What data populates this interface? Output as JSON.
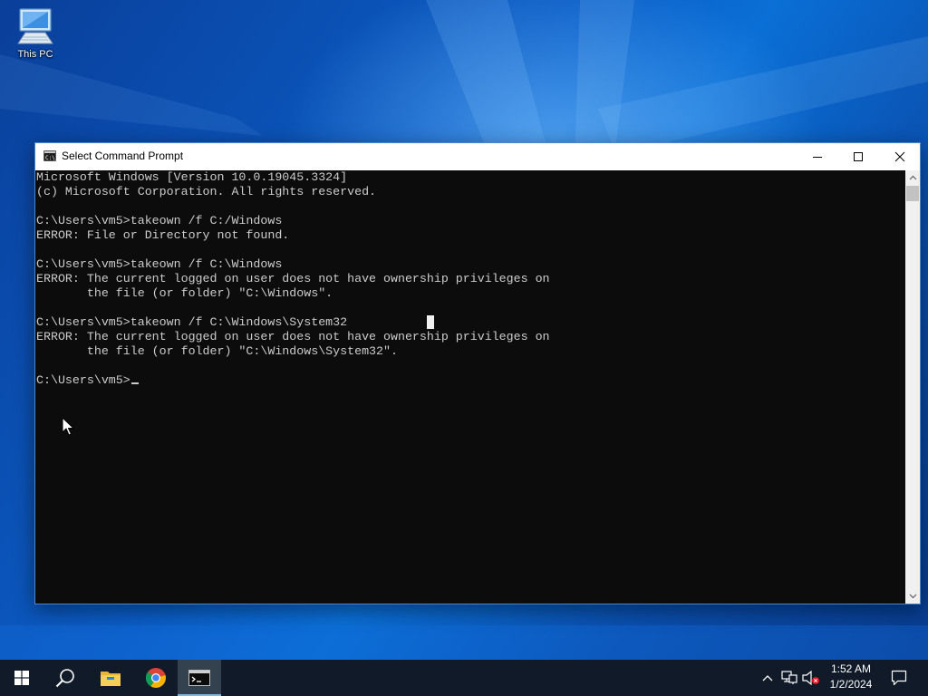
{
  "desktop": {
    "icons": [
      {
        "label": "This PC",
        "icon": "computer-icon"
      }
    ]
  },
  "window": {
    "title": "Select Command Prompt",
    "icon": "cmd-icon",
    "controls": {
      "minimize": "minimize-icon",
      "maximize": "maximize-icon",
      "close": "close-icon"
    }
  },
  "console": {
    "lines": [
      "Microsoft Windows [Version 10.0.19045.3324]",
      "(c) Microsoft Corporation. All rights reserved.",
      "",
      "C:\\Users\\vm5>takeown /f C:/Windows",
      "ERROR: File or Directory not found.",
      "",
      "C:\\Users\\vm5>takeown /f C:\\Windows",
      "ERROR: The current logged on user does not have ownership privileges on",
      "       the file (or folder) \"C:\\Windows\".",
      "",
      "C:\\Users\\vm5>takeown /f C:\\Windows\\System32",
      "ERROR: The current logged on user does not have ownership privileges on",
      "       the file (or folder) \"C:\\Windows\\System32\".",
      "",
      "C:\\Users\\vm5>"
    ]
  },
  "taskbar": {
    "apps": [
      {
        "name": "start",
        "icon": "windows-logo-icon"
      },
      {
        "name": "search",
        "icon": "search-icon"
      },
      {
        "name": "file-explorer",
        "icon": "folder-icon"
      },
      {
        "name": "chrome",
        "icon": "chrome-icon"
      },
      {
        "name": "command-prompt",
        "icon": "cmd-icon",
        "active": true
      }
    ],
    "tray": {
      "icons": [
        "chevron-up-icon",
        "network-icon",
        "volume-muted-icon",
        "notification-icon"
      ]
    },
    "clock": {
      "time": "1:52 AM",
      "date": "1/2/2024"
    }
  },
  "colors": {
    "console_bg": "#0c0c0c",
    "console_text": "#cccccc",
    "taskbar_bg": "#101a28",
    "desktop_accent": "#0a57b8"
  }
}
